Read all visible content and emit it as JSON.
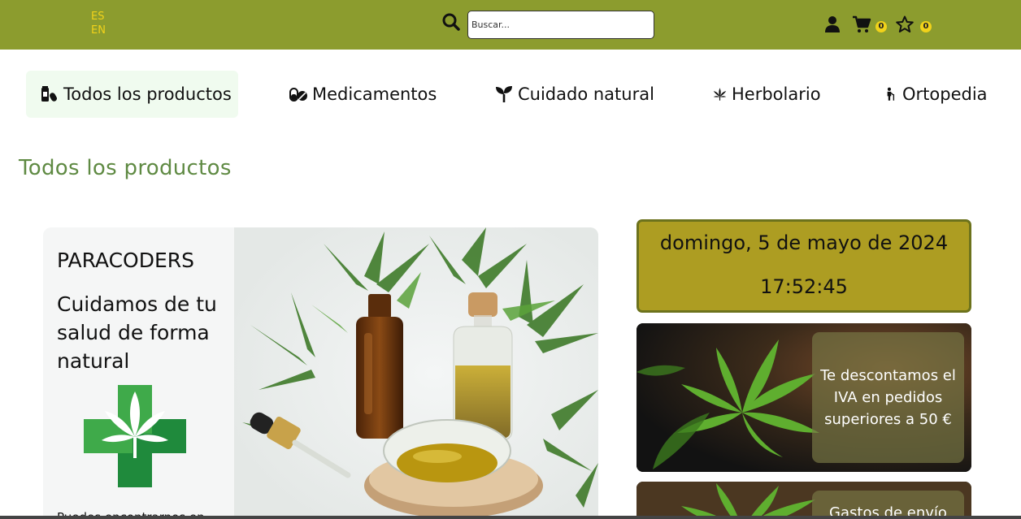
{
  "header": {
    "languages": [
      "ES",
      "EN"
    ],
    "search_placeholder": "Buscar...",
    "cart_count": "0",
    "favorites_count": "0"
  },
  "nav": {
    "items": [
      {
        "label": "Todos los productos",
        "icon": "pills-bottle-icon",
        "active": true
      },
      {
        "label": "Medicamentos",
        "icon": "capsules-icon"
      },
      {
        "label": "Cuidado natural",
        "icon": "seedling-icon"
      },
      {
        "label": "Herbolario",
        "icon": "cannabis-leaf-icon"
      },
      {
        "label": "Ortopedia",
        "icon": "person-cane-icon"
      }
    ]
  },
  "page_title": "Todos los productos",
  "hero": {
    "brand": "PARACODERS",
    "slogan": "Cuidamos de tu salud de forma natural",
    "note": "Puedes encontrarnos en"
  },
  "clock": {
    "date": "domingo, 5 de mayo de 2024",
    "time": "17:52:45"
  },
  "promos": [
    {
      "text": "Te descontamos el IVA en pedidos superiores a 50 €"
    },
    {
      "text": "Gastos de envío"
    }
  ],
  "colors": {
    "topbar": "#8c9c2e",
    "lang_text": "#f1d21a",
    "badge": "#f1d21a",
    "title_green": "#5f8a43",
    "clock_bg": "#ad9d22",
    "clock_border": "#6c721c",
    "nav_active_bg": "#f0fbef"
  }
}
